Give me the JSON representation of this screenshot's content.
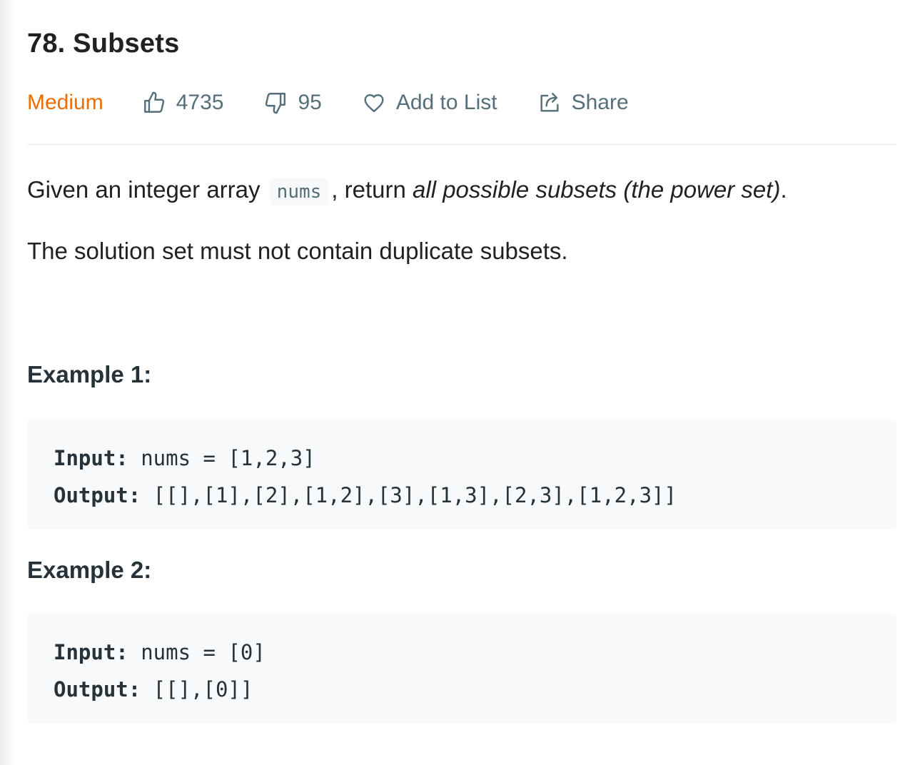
{
  "problem": {
    "title": "78. Subsets",
    "difficulty": "Medium",
    "likes": "4735",
    "dislikes": "95",
    "add_to_list_label": "Add to List",
    "share_label": "Share"
  },
  "description": {
    "line1_before": "Given an integer array ",
    "line1_code": "nums",
    "line1_middle": ", return ",
    "line1_emphasis": "all possible subsets (the power set)",
    "line1_after": ".",
    "line2": "The solution set must not contain duplicate subsets."
  },
  "examples": [
    {
      "title": "Example 1:",
      "input_label": "Input:",
      "input_value": " nums = [1,2,3]",
      "output_label": "Output:",
      "output_value": " [[],[1],[2],[1,2],[3],[1,3],[2,3],[1,2,3]]"
    },
    {
      "title": "Example 2:",
      "input_label": "Input:",
      "input_value": " nums = [0]",
      "output_label": "Output:",
      "output_value": " [[],[0]]"
    }
  ],
  "colors": {
    "difficulty_medium": "#ef6c00",
    "meta_text": "#546e7a",
    "code_background": "#f7f9fa"
  },
  "icons": {
    "like": "thumbs-up-icon",
    "dislike": "thumbs-down-icon",
    "add_to_list": "heart-icon",
    "share": "share-icon"
  }
}
